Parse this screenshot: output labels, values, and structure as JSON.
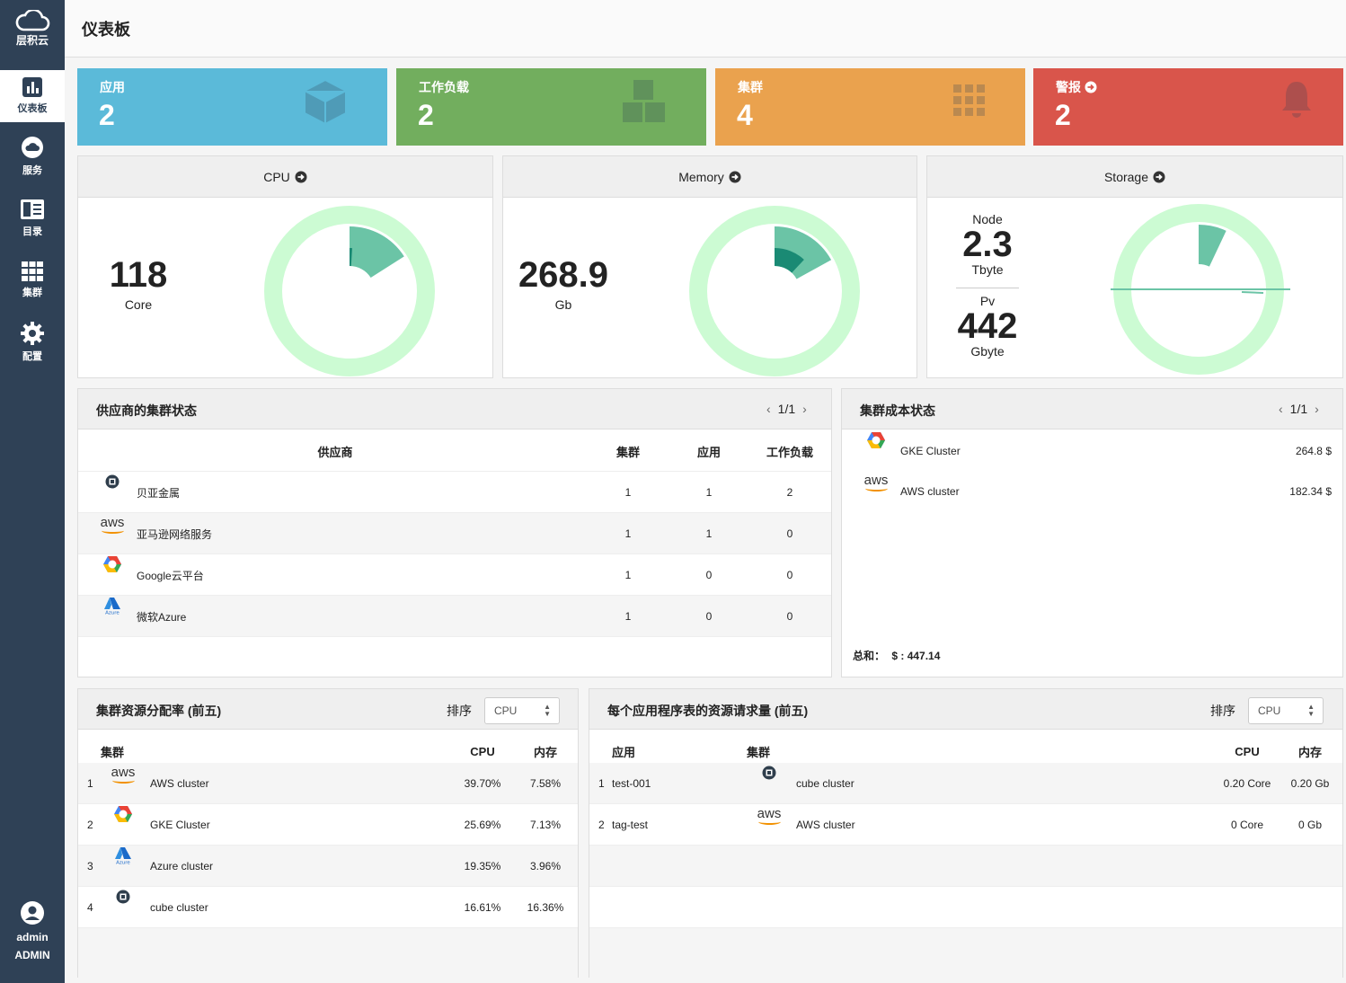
{
  "brand": {
    "name": "层积云"
  },
  "nav": [
    {
      "label": "仪表板",
      "icon": "bar-chart-icon"
    },
    {
      "label": "服务",
      "icon": "cloud-icon"
    },
    {
      "label": "目录",
      "icon": "catalog-icon"
    },
    {
      "label": "集群",
      "icon": "grid-icon"
    },
    {
      "label": "配置",
      "icon": "gear-icon"
    }
  ],
  "user": {
    "name": "admin",
    "role": "ADMIN"
  },
  "page_title": "仪表板",
  "stats": [
    {
      "label": "应用",
      "value": "2",
      "color": "#5bbad9"
    },
    {
      "label": "工作负载",
      "value": "2",
      "color": "#72ae5e"
    },
    {
      "label": "集群",
      "value": "4",
      "color": "#eaa24e"
    },
    {
      "label": "警报",
      "value": "2",
      "color": "#d9554b"
    }
  ],
  "resources": {
    "cpu": {
      "title": "CPU",
      "value": "118",
      "unit": "Core",
      "allocated_fraction": 0.16,
      "used_fraction": 0.01
    },
    "memory": {
      "title": "Memory",
      "value": "268.9",
      "unit": "Gb",
      "allocated_fraction": 0.17,
      "used_fraction": 0.12
    },
    "storage": {
      "title": "Storage",
      "node_label": "Node",
      "node_value": "2.3",
      "node_unit": "Tbyte",
      "pv_label": "Pv",
      "pv_value": "442",
      "pv_unit": "Gbyte",
      "allocated_fraction": 0.07
    }
  },
  "provider_status": {
    "title": "供应商的集群状态",
    "pager": "1/1",
    "columns": [
      "供应商",
      "集群",
      "应用",
      "工作负载"
    ],
    "rows": [
      {
        "provider": "贝亚金属",
        "icon": "cube-icon",
        "clusters": "1",
        "apps": "1",
        "workloads": "2"
      },
      {
        "provider": "亚马逊网络服务",
        "icon": "aws-icon",
        "clusters": "1",
        "apps": "1",
        "workloads": "0"
      },
      {
        "provider": "Google云平台",
        "icon": "google-cloud-icon",
        "clusters": "1",
        "apps": "0",
        "workloads": "0"
      },
      {
        "provider": "微软Azure",
        "icon": "azure-icon",
        "clusters": "1",
        "apps": "0",
        "workloads": "0"
      }
    ]
  },
  "cost_status": {
    "title": "集群成本状态",
    "pager": "1/1",
    "rows": [
      {
        "name": "GKE Cluster",
        "icon": "google-cloud-icon",
        "cost": "264.8 $"
      },
      {
        "name": "AWS cluster",
        "icon": "aws-icon",
        "cost": "182.34 $"
      }
    ],
    "total_label": "总和：",
    "total_value": "$ : 447.14"
  },
  "allocation": {
    "title": "集群资源分配率 (前五)",
    "sort_label": "排序",
    "sort_value": "CPU",
    "columns": [
      "集群",
      "CPU",
      "内存"
    ],
    "rows": [
      {
        "rank": "1",
        "icon": "aws-icon",
        "name": "AWS cluster",
        "cpu": "39.70%",
        "mem": "7.58%"
      },
      {
        "rank": "2",
        "icon": "google-cloud-icon",
        "name": "GKE Cluster",
        "cpu": "25.69%",
        "mem": "7.13%"
      },
      {
        "rank": "3",
        "icon": "azure-icon",
        "name": "Azure cluster",
        "cpu": "19.35%",
        "mem": "3.96%"
      },
      {
        "rank": "4",
        "icon": "cube-icon",
        "name": "cube cluster",
        "cpu": "16.61%",
        "mem": "16.36%"
      }
    ]
  },
  "app_requests": {
    "title": "每个应用程序表的资源请求量 (前五)",
    "sort_label": "排序",
    "sort_value": "CPU",
    "columns": [
      "应用",
      "集群",
      "CPU",
      "内存"
    ],
    "rows": [
      {
        "rank": "1",
        "app": "test-001",
        "icon": "cube-icon",
        "cluster": "cube cluster",
        "cpu": "0.20 Core",
        "mem": "0.20 Gb"
      },
      {
        "rank": "2",
        "app": "tag-test",
        "icon": "aws-icon",
        "cluster": "AWS cluster",
        "cpu": "0 Core",
        "mem": "0 Gb"
      }
    ]
  }
}
